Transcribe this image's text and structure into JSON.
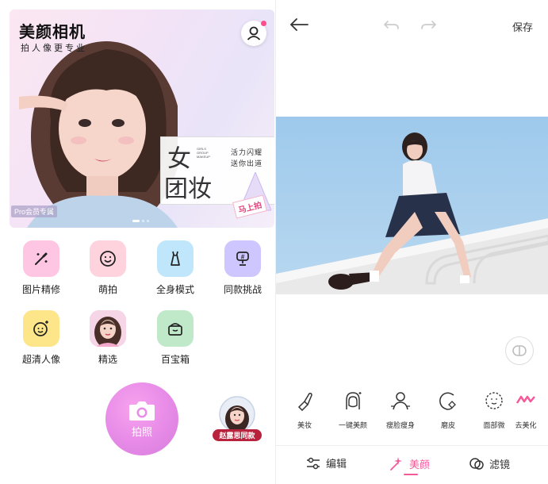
{
  "app": {
    "title": "美颜相机",
    "slogan": "拍人像更专业"
  },
  "banner": {
    "promo_main_line1": "女",
    "promo_main_line2": "团妆",
    "promo_tag": "GIRLS GROUP MAKEUP",
    "promo_sub_line1": "活力闪耀",
    "promo_sub_line2": "送你出道",
    "promo_cta": "马上拍",
    "pro_badge": "Pro会员专属",
    "page_count": 3,
    "active_page": 0
  },
  "tools": [
    {
      "label": "图片精修",
      "icon": "magic-wand-icon",
      "color": "#ffc6e3"
    },
    {
      "label": "萌拍",
      "icon": "smiley-face-icon",
      "color": "#ffd3dd"
    },
    {
      "label": "全身模式",
      "icon": "dress-icon",
      "color": "#bfe6fb"
    },
    {
      "label": "同款挑战",
      "icon": "trophy-icon",
      "color": "#cdc6ff"
    },
    {
      "label": "超清人像",
      "icon": "sparkle-face-icon",
      "color": "#fde58a"
    },
    {
      "label": "精选",
      "icon": "featured-photo-icon",
      "color": "#f4cde0"
    },
    {
      "label": "百宝箱",
      "icon": "treasure-box-icon",
      "color": "#bfe9c9"
    }
  ],
  "shutter": {
    "label": "拍照"
  },
  "avatar_badge": {
    "label": "赵露思同款"
  },
  "editor": {
    "save_label": "保存",
    "beauty_tools": [
      {
        "label": "美妆",
        "icon": "lipstick-icon"
      },
      {
        "label": "一键美颜",
        "icon": "hair-face-icon"
      },
      {
        "label": "瘦脸瘦身",
        "icon": "body-slim-icon"
      },
      {
        "label": "磨皮",
        "icon": "smooth-skin-icon"
      },
      {
        "label": "面部微",
        "icon": "face-contour-icon"
      },
      {
        "label": "去美化",
        "icon": "remove-beauty-icon"
      }
    ],
    "tabs": [
      {
        "label": "编辑",
        "icon": "sliders-icon",
        "active": false
      },
      {
        "label": "美颜",
        "icon": "magic-sparkle-icon",
        "active": true
      },
      {
        "label": "滤镜",
        "icon": "filter-icon",
        "active": false
      }
    ],
    "accent_color": "#f25a9a"
  }
}
